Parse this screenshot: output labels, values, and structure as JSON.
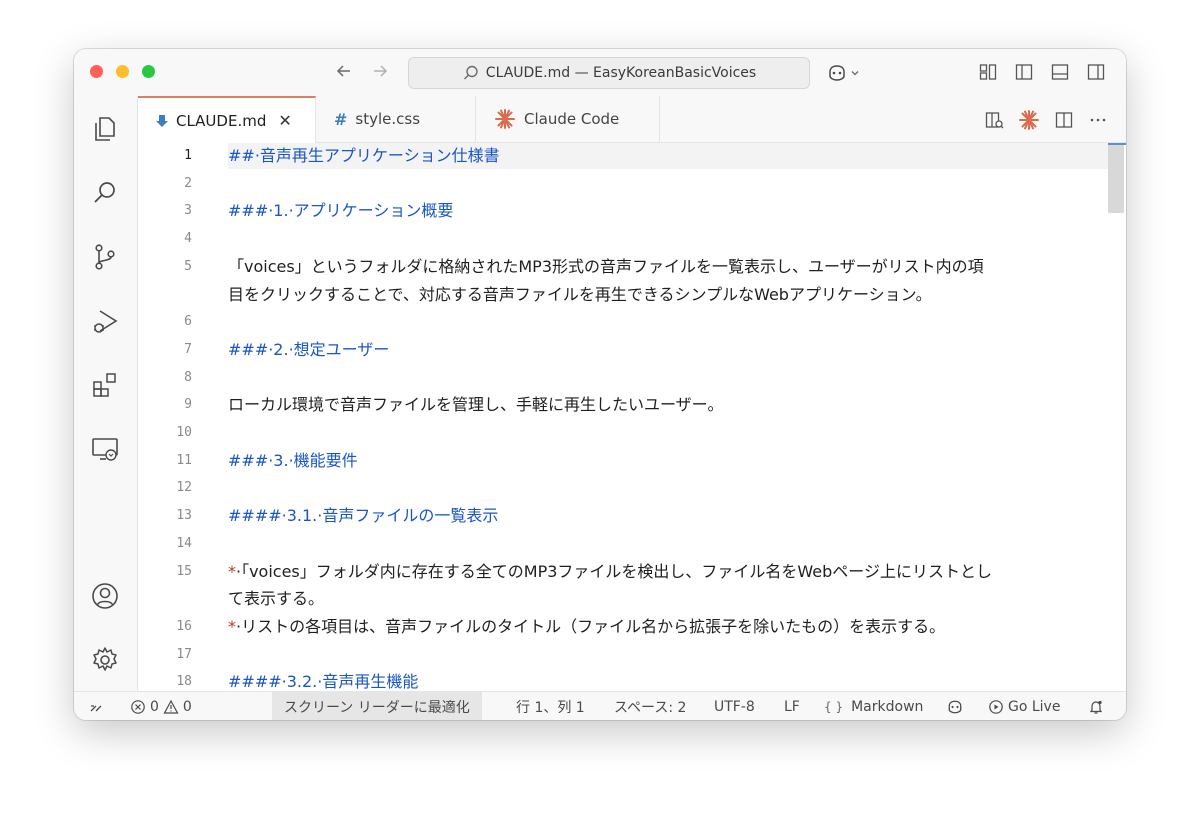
{
  "window": {
    "title": "CLAUDE.md — EasyKoreanBasicVoices"
  },
  "tabs": [
    {
      "label": "CLAUDE.md",
      "icon": "markdown-arrow-icon",
      "active": true
    },
    {
      "label": "style.css",
      "icon": "hash-icon",
      "active": false
    },
    {
      "label": "Claude Code",
      "icon": "claude-sparkle-icon",
      "active": false
    }
  ],
  "tab_close": "✕",
  "editor": {
    "lines": [
      {
        "n": "1",
        "text": "##·音声再生アプリケーション仕様書",
        "kind": "h"
      },
      {
        "n": "2",
        "text": "",
        "kind": "p"
      },
      {
        "n": "3",
        "text": "###·1.·アプリケーション概要",
        "kind": "h"
      },
      {
        "n": "4",
        "text": "",
        "kind": "p"
      },
      {
        "n": "5",
        "text": "「voices」というフォルダに格納されたMP3形式の音声ファイルを一覧表示し、ユーザーがリスト内の項",
        "kind": "p"
      },
      {
        "n": "",
        "text": "目をクリックすることで、対応する音声ファイルを再生できるシンプルなWebアプリケーション。",
        "kind": "p"
      },
      {
        "n": "6",
        "text": "",
        "kind": "p"
      },
      {
        "n": "7",
        "text": "###·2.·想定ユーザー",
        "kind": "h"
      },
      {
        "n": "8",
        "text": "",
        "kind": "p"
      },
      {
        "n": "9",
        "text": "ローカル環境で音声ファイルを管理し、手軽に再生したいユーザー。",
        "kind": "p"
      },
      {
        "n": "10",
        "text": "",
        "kind": "p"
      },
      {
        "n": "11",
        "text": "###·3.·機能要件",
        "kind": "h"
      },
      {
        "n": "12",
        "text": "",
        "kind": "p"
      },
      {
        "n": "13",
        "text": "####·3.1.·音声ファイルの一覧表示",
        "kind": "h"
      },
      {
        "n": "14",
        "text": "",
        "kind": "p"
      },
      {
        "n": "15",
        "text": "*·「voices」フォルダ内に存在する全てのMP3ファイルを検出し、ファイル名をWebページ上にリストとし",
        "kind": "b"
      },
      {
        "n": "",
        "text": "て表示する。",
        "kind": "p"
      },
      {
        "n": "16",
        "text": "*·リストの各項目は、音声ファイルのタイトル（ファイル名から拡張子を除いたもの）を表示する。",
        "kind": "b"
      },
      {
        "n": "17",
        "text": "",
        "kind": "p"
      },
      {
        "n": "18",
        "text": "####·3.2.·音声再生機能",
        "kind": "h"
      }
    ]
  },
  "status": {
    "errors": "0",
    "warnings": "0",
    "screen_reader": "スクリーン リーダーに最適化",
    "position": "行 1、列 1",
    "spaces": "スペース: 2",
    "encoding": "UTF-8",
    "eol": "LF",
    "language_braces": "{ }",
    "language": "Markdown",
    "go_live": "Go Live"
  },
  "colors": {
    "heading": "#1a56c4",
    "bullet": "#b03a2e",
    "active_tab_border": "#e07c65"
  }
}
